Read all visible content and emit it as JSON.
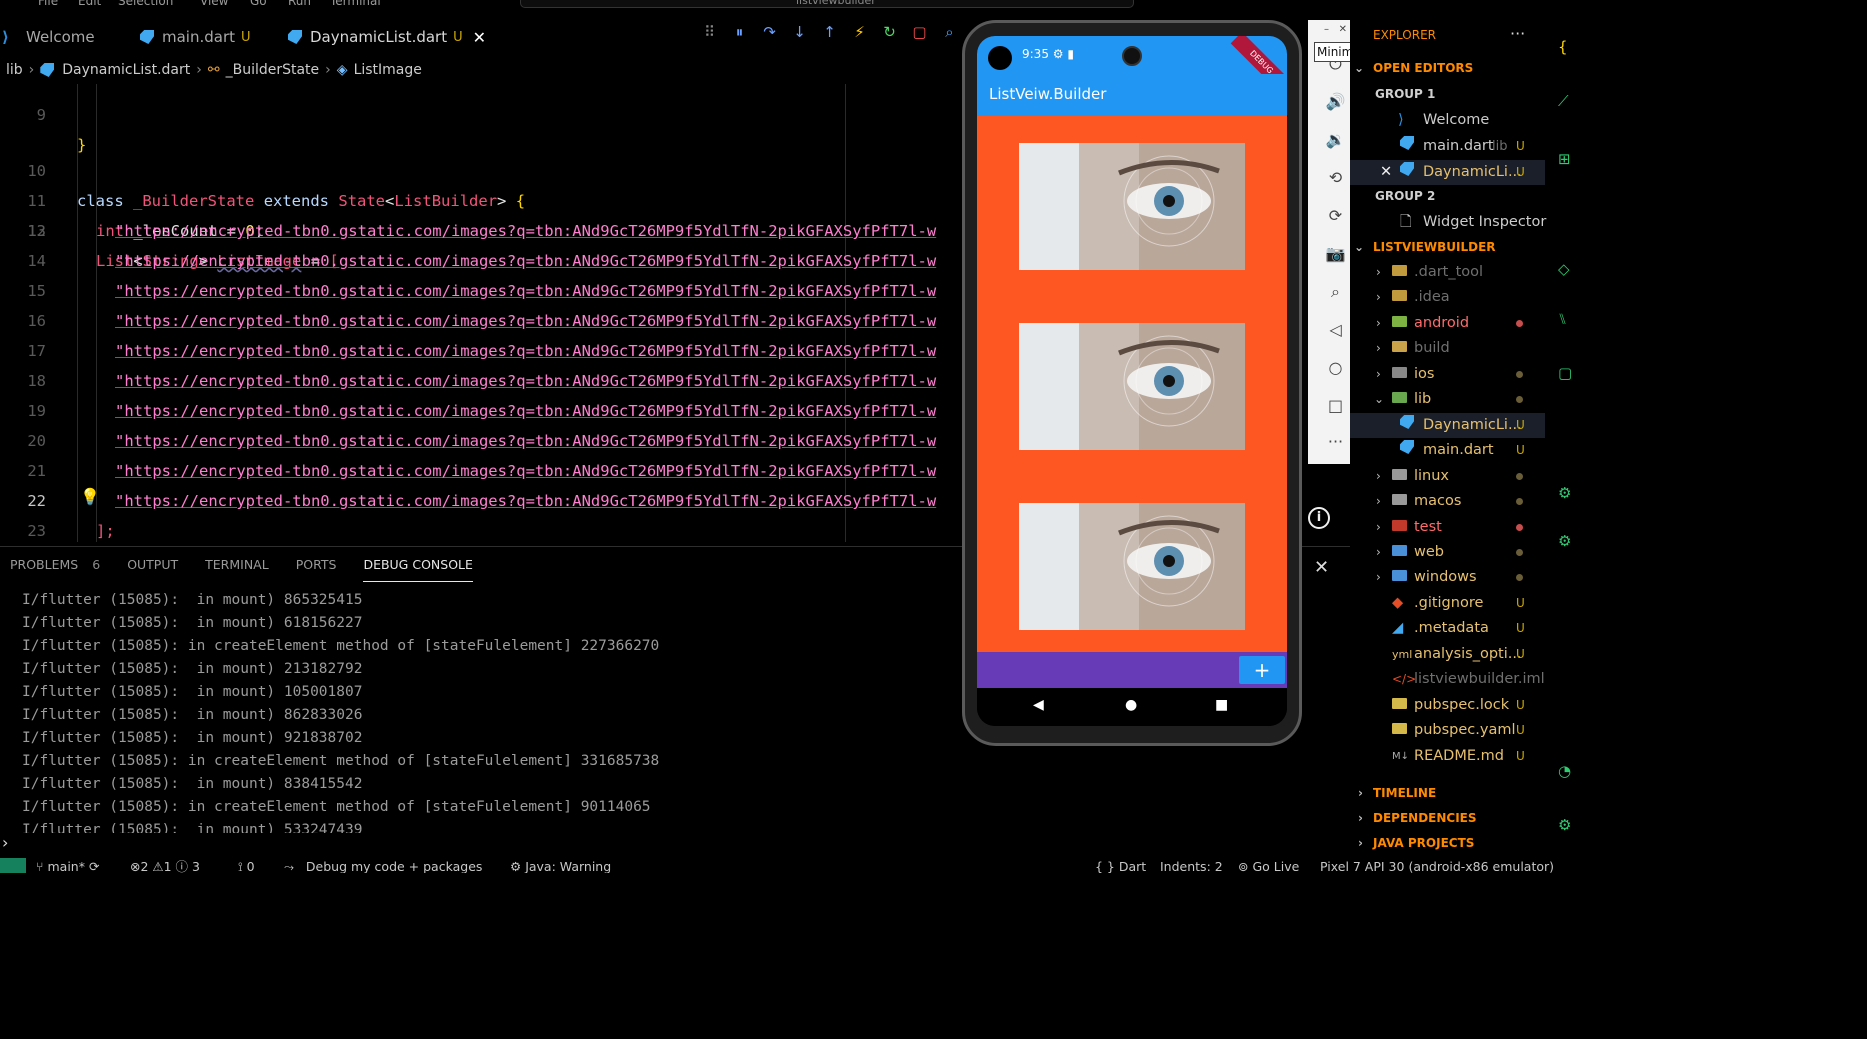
{
  "menubar": {
    "items": [
      "File",
      "Edit",
      "Selection",
      "View",
      "Go",
      "Run",
      "Terminal"
    ],
    "command_center": "listviewbuilder"
  },
  "tabs": [
    {
      "label": "Welcome",
      "modified": ""
    },
    {
      "label": "main.dart",
      "modified": "U"
    },
    {
      "label": "DaynamicList.dart",
      "modified": "U"
    }
  ],
  "breadcrumb": [
    "lib",
    "DaynamicList.dart",
    "_BuilderState",
    "ListImage"
  ],
  "editor": {
    "lines": [
      {
        "n": "9",
        "code": "}"
      },
      {
        "n": "10",
        "code": "class _BuilderState extends State<ListBuilder> {"
      },
      {
        "n": "11",
        "code": "int _lenCount = 0;"
      },
      {
        "n": "12",
        "code": "List<String> ListImage = ["
      },
      {
        "n": "13",
        "code": "\"https://encrypted-tbn0.gstatic.com/images?q=tbn:ANd9GcT26MP9f5YdlTfN-2pikGFAXSyfPfT7l-w"
      },
      {
        "n": "14",
        "code": "\"https://encrypted-tbn0.gstatic.com/images?q=tbn:ANd9GcT26MP9f5YdlTfN-2pikGFAXSyfPfT7l-w"
      },
      {
        "n": "15",
        "code": "\"https://encrypted-tbn0.gstatic.com/images?q=tbn:ANd9GcT26MP9f5YdlTfN-2pikGFAXSyfPfT7l-w"
      },
      {
        "n": "16",
        "code": "\"https://encrypted-tbn0.gstatic.com/images?q=tbn:ANd9GcT26MP9f5YdlTfN-2pikGFAXSyfPfT7l-w"
      },
      {
        "n": "17",
        "code": "\"https://encrypted-tbn0.gstatic.com/images?q=tbn:ANd9GcT26MP9f5YdlTfN-2pikGFAXSyfPfT7l-w"
      },
      {
        "n": "18",
        "code": "\"https://encrypted-tbn0.gstatic.com/images?q=tbn:ANd9GcT26MP9f5YdlTfN-2pikGFAXSyfPfT7l-w"
      },
      {
        "n": "19",
        "code": "\"https://encrypted-tbn0.gstatic.com/images?q=tbn:ANd9GcT26MP9f5YdlTfN-2pikGFAXSyfPfT7l-w"
      },
      {
        "n": "20",
        "code": "\"https://encrypted-tbn0.gstatic.com/images?q=tbn:ANd9GcT26MP9f5YdlTfN-2pikGFAXSyfPfT7l-w"
      },
      {
        "n": "21",
        "code": "\"https://encrypted-tbn0.gstatic.com/images?q=tbn:ANd9GcT26MP9f5YdlTfN-2pikGFAXSyfPfT7l-w"
      },
      {
        "n": "22",
        "code": "\"https://encrypted-tbn0.gstatic.com/images?q=tbn:ANd9GcT26MP9f5YdlTfN-2pikGFAXSyfPfT7l-w"
      },
      {
        "n": "23",
        "code": "];"
      }
    ],
    "class_kw": "class",
    "class_name": "_BuilderState",
    "extends_kw": "extends",
    "state_type": "State",
    "generic_type": "ListBuilder",
    "int_kw": "int",
    "len_var": "_lenCount = ",
    "len_value": "0",
    "list_type": "List",
    "string_type": "String",
    "list_var": "ListImage",
    "url": "\"https://encrypted-tbn0.gstatic.com/images?q=tbn:ANd9GcT26MP9f5YdlTfN-2pikGFAXSyfPfT7l-w"
  },
  "panel": {
    "tabs": [
      {
        "label": "PROBLEMS",
        "badge": "6"
      },
      {
        "label": "OUTPUT",
        "badge": ""
      },
      {
        "label": "TERMINAL",
        "badge": ""
      },
      {
        "label": "PORTS",
        "badge": ""
      },
      {
        "label": "DEBUG CONSOLE",
        "badge": ""
      }
    ],
    "logs": [
      "I/flutter (15085):  in mount) 865325415",
      "I/flutter (15085):  in mount) 618156227",
      "I/flutter (15085): in createElement method of [stateFulelement] 227366270",
      "I/flutter (15085):  in mount) 213182792",
      "I/flutter (15085):  in mount) 105001807",
      "I/flutter (15085):  in mount) 862833026",
      "I/flutter (15085):  in mount) 921838702",
      "I/flutter (15085): in createElement method of [stateFulelement] 331685738",
      "I/flutter (15085):  in mount) 838415542",
      "I/flutter (15085): in createElement method of [stateFulelement] 90114065",
      "I/flutter (15085):  in mount) 533247439"
    ]
  },
  "phone": {
    "time": "9:35",
    "debug_banner": "DEBUG",
    "appbar_title": "ListVeiw.Builder",
    "fab_label": "+"
  },
  "emulator_toolbar": {
    "tooltip": "Minimize"
  },
  "explorer": {
    "title": "EXPLORER",
    "open_editors": "OPEN EDITORS",
    "group1": "GROUP 1",
    "group1_items": [
      {
        "name": "Welcome",
        "hint": "",
        "mark": ""
      },
      {
        "name": "main.dart",
        "hint": "lib",
        "mark": "U"
      },
      {
        "name": "DaynamicLi...",
        "hint": "",
        "mark": "U"
      }
    ],
    "group2": "GROUP 2",
    "group2_items": [
      {
        "name": "Widget Inspector"
      }
    ],
    "project": "LISTVIEWBUILDER",
    "tree": [
      {
        "name": ".dart_tool",
        "mark": ""
      },
      {
        "name": ".idea",
        "mark": ""
      },
      {
        "name": "android",
        "mark": ""
      },
      {
        "name": "build",
        "mark": ""
      },
      {
        "name": "ios",
        "mark": ""
      },
      {
        "name": "lib",
        "mark": ""
      },
      {
        "name": "DaynamicLi...",
        "mark": "U"
      },
      {
        "name": "main.dart",
        "mark": "U"
      },
      {
        "name": "linux",
        "mark": ""
      },
      {
        "name": "macos",
        "mark": ""
      },
      {
        "name": "test",
        "mark": ""
      },
      {
        "name": "web",
        "mark": ""
      },
      {
        "name": "windows",
        "mark": ""
      },
      {
        "name": ".gitignore",
        "mark": "U"
      },
      {
        "name": ".metadata",
        "mark": "U"
      },
      {
        "name": "analysis_opti...",
        "mark": "U"
      },
      {
        "name": "listviewbuilder.iml",
        "mark": ""
      },
      {
        "name": "pubspec.lock",
        "mark": "U"
      },
      {
        "name": "pubspec.yaml",
        "mark": "U"
      },
      {
        "name": "README.md",
        "mark": "U"
      }
    ],
    "timeline": "TIMELINE",
    "dependencies": "DEPENDENCIES",
    "java_projects": "JAVA PROJECTS"
  },
  "statusbar": {
    "branch": "main*",
    "problems": "⊗2 ⚠1 ⓘ 3",
    "ports": "0",
    "debug": "Debug my code + packages",
    "java": "Java: Warning",
    "lang": "Dart",
    "indent": "Indents: 2",
    "golive": "Go Live",
    "device": "Pixel 7 API 30 (android-x86 emulator)"
  },
  "colors": {
    "accent": "#2196f3",
    "body": "#ff5722",
    "bottombar": "#673ab7",
    "section": "#ff8a00"
  }
}
